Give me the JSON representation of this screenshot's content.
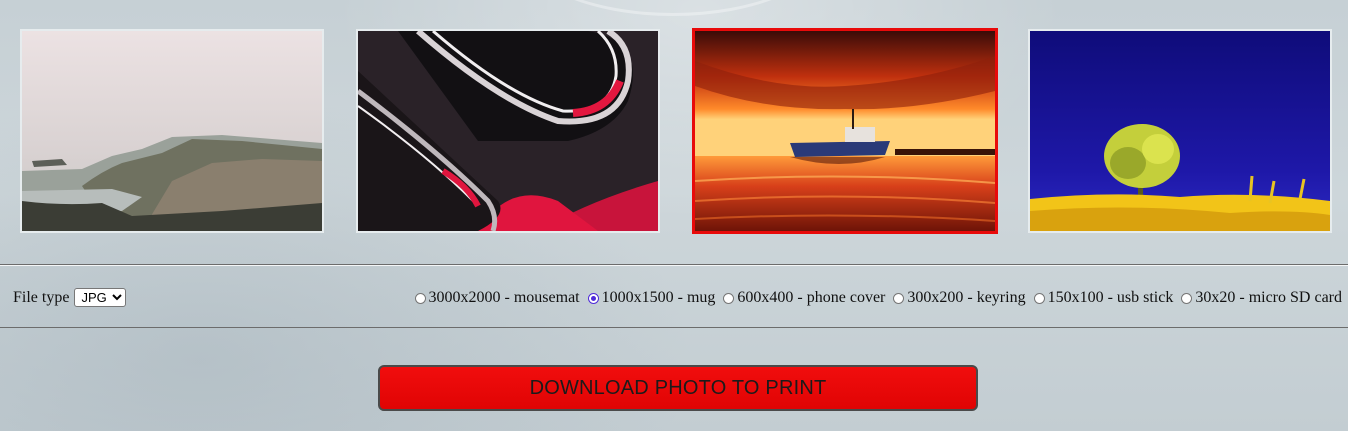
{
  "gallery": {
    "photos": [
      {
        "name": "misty-coastline-photo",
        "selected": false
      },
      {
        "name": "red-abstract-curves-photo",
        "selected": false
      },
      {
        "name": "boat-at-sunset-photo",
        "selected": true
      },
      {
        "name": "tree-in-yellow-field-photo",
        "selected": false
      }
    ],
    "selected_border_color": "#e80a0a"
  },
  "file_type": {
    "label": "File type",
    "selected": "JPG",
    "options": [
      "JPG"
    ]
  },
  "sizes": [
    {
      "label": "3000x2000 - mousemat",
      "checked": false
    },
    {
      "label": "1000x1500 - mug",
      "checked": true
    },
    {
      "label": "600x400 - phone cover",
      "checked": false
    },
    {
      "label": "300x200 - keyring",
      "checked": false
    },
    {
      "label": "150x100 - usb stick",
      "checked": false
    },
    {
      "label": "30x20 - micro SD card",
      "checked": false
    }
  ],
  "download": {
    "label": "DOWNLOAD PHOTO TO PRINT",
    "color": "#e80808"
  }
}
